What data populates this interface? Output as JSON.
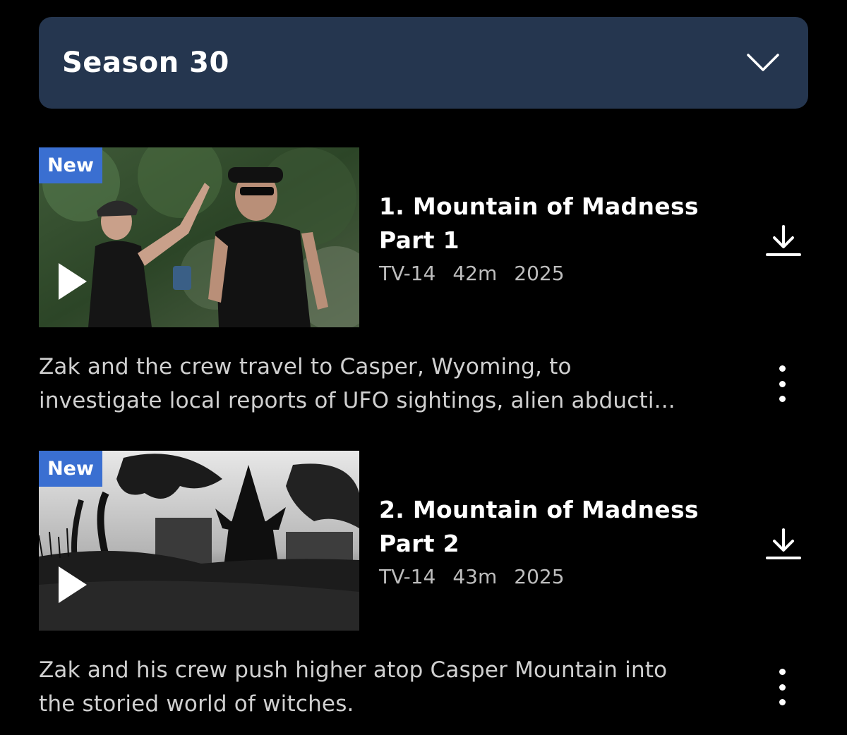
{
  "season_selector": {
    "label": "Season 30",
    "icon": "chevron-down-icon"
  },
  "episodes": [
    {
      "badge": "New",
      "title_line1": "1. Mountain of Madness",
      "title_line2": "Part 1",
      "rating": "TV-14",
      "duration": "42m",
      "year": "2025",
      "description_line1": "Zak and the crew travel to Casper, Wyoming, to",
      "description_line2": "investigate local reports of UFO sightings, alien abducti...",
      "thumbnail_icon": "play-icon",
      "download_icon": "download-icon",
      "more_icon": "more-vertical-icon"
    },
    {
      "badge": "New",
      "title_line1": "2. Mountain of Madness",
      "title_line2": "Part 2",
      "rating": "TV-14",
      "duration": "43m",
      "year": "2025",
      "description_line1": "Zak and his crew push higher atop Casper Mountain into",
      "description_line2": "the storied world of witches.",
      "thumbnail_icon": "play-icon",
      "download_icon": "download-icon",
      "more_icon": "more-vertical-icon"
    }
  ],
  "colors": {
    "background": "#000000",
    "selector_bg": "#25364f",
    "badge_bg": "#3a6fd1",
    "meta_text": "#bdbdbd",
    "desc_text": "#d0d0d0"
  }
}
